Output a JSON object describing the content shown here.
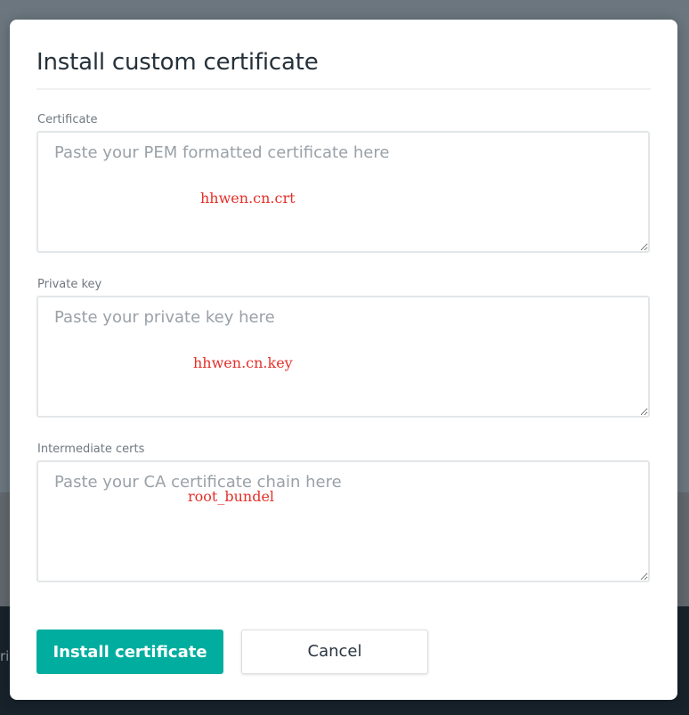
{
  "background": {
    "peek_text": "ri"
  },
  "dialog": {
    "title": "Install custom certificate",
    "fields": {
      "certificate": {
        "label": "Certificate",
        "placeholder": "Paste your PEM formatted certificate here",
        "value": "",
        "annotation": "hhwen.cn.crt"
      },
      "private_key": {
        "label": "Private key",
        "placeholder": "Paste your private key here",
        "value": "",
        "annotation": "hhwen.cn.key"
      },
      "intermediate": {
        "label": "Intermediate certs",
        "placeholder": "Paste your CA certificate chain here",
        "value": "",
        "annotation": "root_bundel"
      }
    },
    "buttons": {
      "install": "Install certificate",
      "cancel": "Cancel"
    }
  },
  "colors": {
    "accent": "#00ad9f",
    "annotation": "#e5302a",
    "overlay": "#6b767e",
    "footer_dark": "#18222b"
  }
}
